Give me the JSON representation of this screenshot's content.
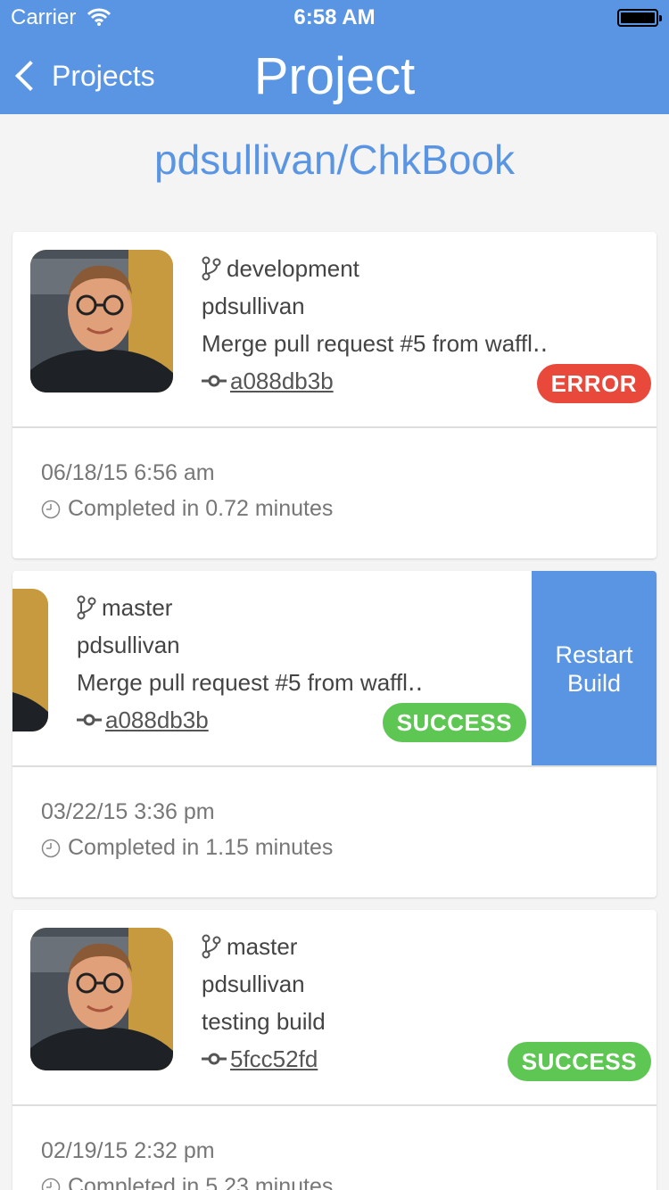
{
  "status_bar": {
    "carrier": "Carrier",
    "time": "6:58 AM"
  },
  "nav": {
    "back_label": "Projects",
    "title": "Project"
  },
  "repo_title": "pdsullivan/ChkBook",
  "colors": {
    "accent": "#5a95e3",
    "error": "#e9493b",
    "success": "#5ec653"
  },
  "builds": [
    {
      "branch": "development",
      "author": "pdsullivan",
      "message": "Merge pull request #5 from waffl‥",
      "commit": " a088db3b",
      "status": "ERROR",
      "date": "06/18/15 6:56 am",
      "duration": "Completed in 0.72 minutes"
    },
    {
      "branch": "master",
      "author": "pdsullivan",
      "message": "Merge pull request #5 from waffl‥",
      "commit": " a088db3b",
      "status": "SUCCESS",
      "date": "03/22/15 3:36 pm",
      "duration": "Completed in 1.15 minutes",
      "action_line1": "Restart",
      "action_line2": "Build"
    },
    {
      "branch": "master",
      "author": "pdsullivan",
      "message": "testing build",
      "commit": " 5fcc52fd",
      "status": "SUCCESS",
      "date": "02/19/15 2:32 pm",
      "duration": "Completed in 5.23 minutes"
    }
  ]
}
